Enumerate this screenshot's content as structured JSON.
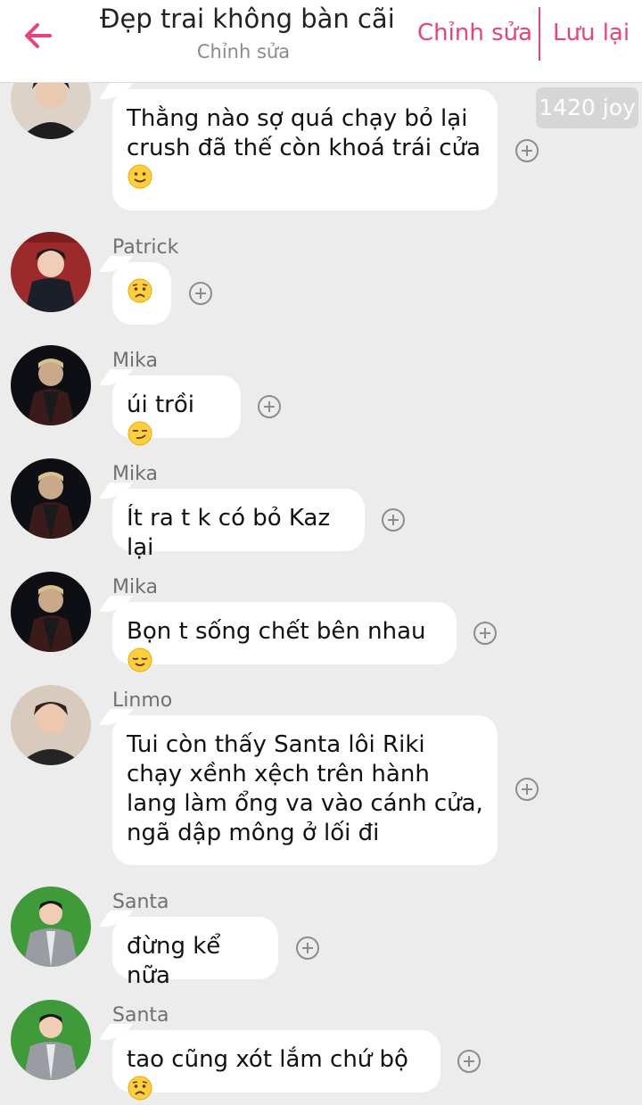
{
  "header": {
    "title": "Đẹp trai không bàn cãi",
    "subtitle": "Chỉnh sửa",
    "edit_label": "Chỉnh sửa",
    "save_label": "Lưu lại",
    "accent_color": "#e8437c"
  },
  "joy_badge": "1420 joy",
  "messages": [
    {
      "sender": "",
      "text": "Thằng nào sợ quá chạy bỏ lại crush đã thế còn khoá trái cửa",
      "emoji": "slightly-smiling-face"
    },
    {
      "sender": "Patrick",
      "text": "",
      "emoji": "worried-face"
    },
    {
      "sender": "Mika",
      "text": "úi trồi",
      "emoji": "smirking-face"
    },
    {
      "sender": "Mika",
      "text": "Ít ra t k có bỏ Kaz lại",
      "emoji": ""
    },
    {
      "sender": "Mika",
      "text": "Bọn t sống chết bên nhau",
      "emoji": "relieved-face"
    },
    {
      "sender": "Linmo",
      "text": "Tui còn thấy Santa lôi Riki chạy xềnh xệch trên hành lang làm ổng va vào cánh cửa, ngã dập mông ở lối đi",
      "emoji": ""
    },
    {
      "sender": "Santa",
      "text": "đừng kể nữa",
      "emoji": ""
    },
    {
      "sender": "Santa",
      "text": "tao cũng xót lắm chứ bộ",
      "emoji": "worried-face"
    }
  ]
}
